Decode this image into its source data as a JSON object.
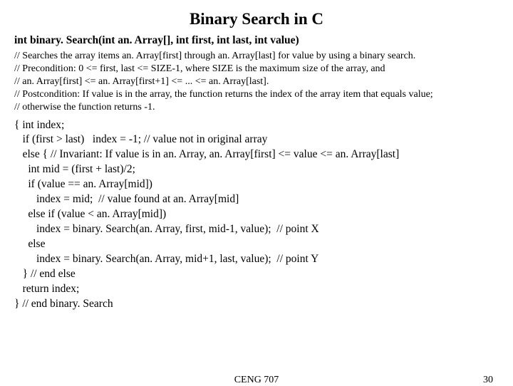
{
  "title": "Binary Search in C",
  "signature": "int binary. Search(int an. Array[], int first, int last, int value)",
  "comments": [
    "// Searches the array items an. Array[first] through an. Array[last] for value by using a binary search.",
    "// Precondition: 0 <= first, last <= SIZE-1, where SIZE is the maximum size of the array, and",
    "// an. Array[first] <= an. Array[first+1] <= ... <= an. Array[last].",
    "// Postcondition: If value is in the array, the function returns the index of the array item that equals value;",
    "// otherwise the function returns -1."
  ],
  "code": [
    "{ int index;",
    "   if (first > last)   index = -1; // value not in original array",
    "   else { // Invariant: If value is in an. Array, an. Array[first] <= value <= an. Array[last]",
    "     int mid = (first + last)/2;",
    "     if (value == an. Array[mid])",
    "        index = mid;  // value found at an. Array[mid]",
    "     else if (value < an. Array[mid])",
    "        index = binary. Search(an. Array, first, mid-1, value);  // point X",
    "     else",
    "        index = binary. Search(an. Array, mid+1, last, value);  // point Y",
    "   } // end else",
    "   return index;",
    "} // end binary. Search"
  ],
  "footer": {
    "center": "CENG 707",
    "page": "30"
  }
}
